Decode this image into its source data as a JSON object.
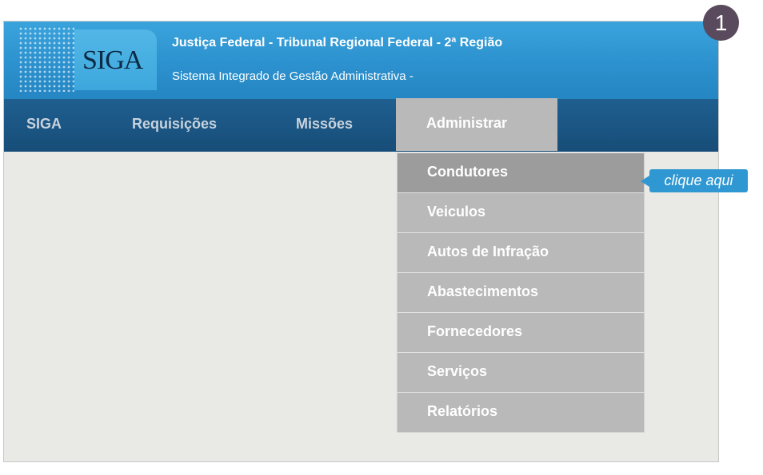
{
  "header": {
    "logo_text": "SIGA",
    "title": "Justiça Federal - Tribunal Regional Federal - 2ª Região",
    "subtitle": "Sistema Integrado de Gestão Administrativa -"
  },
  "nav": {
    "items": [
      {
        "label": "SIGA"
      },
      {
        "label": "Requisições"
      },
      {
        "label": "Missões"
      },
      {
        "label": "Administrar",
        "active": true
      }
    ]
  },
  "dropdown": {
    "items": [
      {
        "label": "Condutores",
        "highlighted": true
      },
      {
        "label": "Veiculos"
      },
      {
        "label": "Autos de Infração"
      },
      {
        "label": "Abastecimentos"
      },
      {
        "label": "Fornecedores"
      },
      {
        "label": "Serviços"
      },
      {
        "label": "Relatórios"
      }
    ]
  },
  "annotation": {
    "callout_text": "clique aqui",
    "step_number": "1"
  },
  "colors": {
    "header_blue": "#2b90cd",
    "nav_blue": "#1b5683",
    "menu_grey": "#b9b9b9",
    "menu_highlight": "#9c9c9c",
    "callout_blue": "#2f97d1",
    "badge": "#5a4a5d"
  }
}
